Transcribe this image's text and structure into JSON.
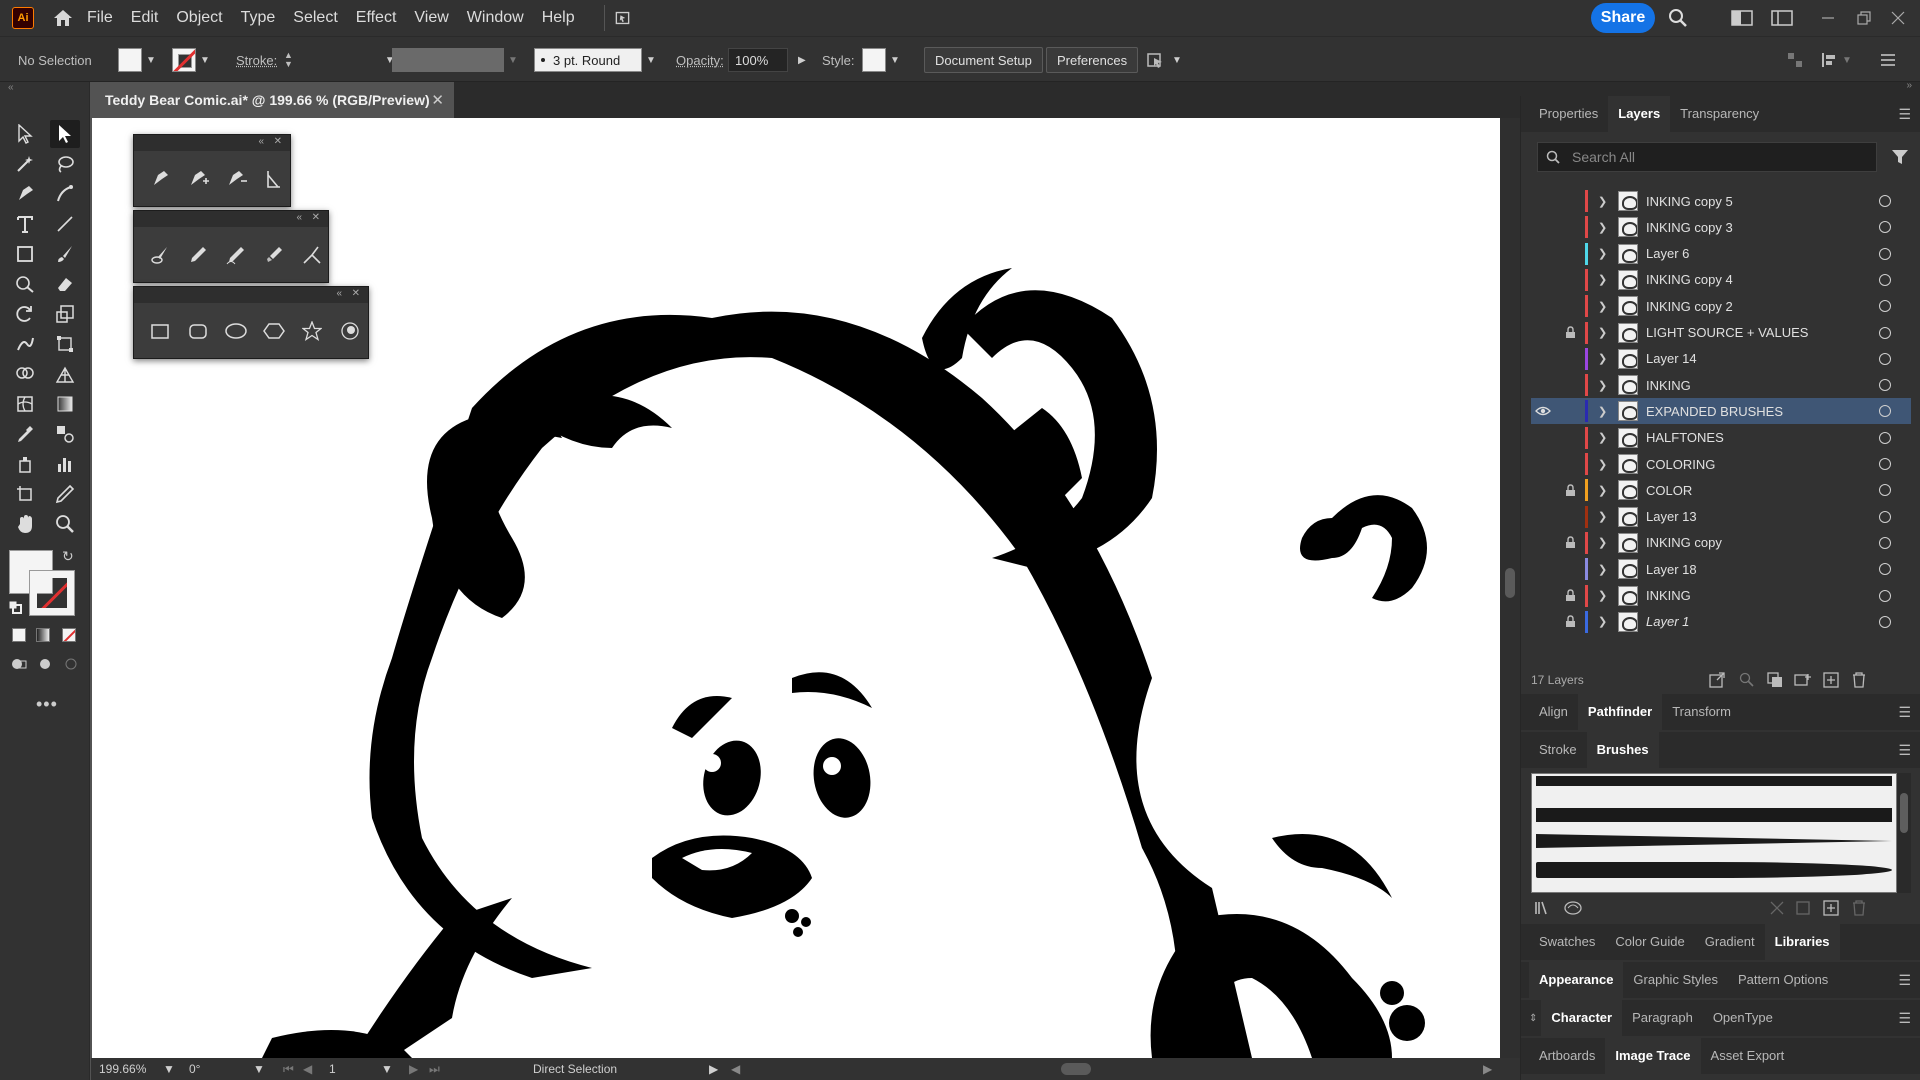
{
  "app": {
    "logo": "Ai",
    "doc_tab": "Teddy Bear Comic.ai* @ 199.66 % (RGB/Preview)"
  },
  "menu": [
    "File",
    "Edit",
    "Object",
    "Type",
    "Select",
    "Effect",
    "View",
    "Window",
    "Help"
  ],
  "share_label": "Share",
  "control": {
    "selection": "No Selection",
    "stroke_label": "Stroke:",
    "brush": "3 pt. Round",
    "opacity_label": "Opacity:",
    "opacity_value": "100%",
    "style_label": "Style:",
    "doc_setup": "Document Setup",
    "preferences": "Preferences"
  },
  "layers_panel": {
    "tabs": [
      "Properties",
      "Layers",
      "Transparency"
    ],
    "active_tab": "Layers",
    "search_placeholder": "Search All",
    "layers": [
      {
        "name": "INKING copy 5",
        "color": "#e04848",
        "locked": false,
        "visible": false
      },
      {
        "name": "INKING copy 3",
        "color": "#e04848",
        "locked": false,
        "visible": false
      },
      {
        "name": "Layer 6",
        "color": "#4fd7e8",
        "locked": false,
        "visible": false
      },
      {
        "name": "INKING copy 4",
        "color": "#e04848",
        "locked": false,
        "visible": false
      },
      {
        "name": "INKING copy 2",
        "color": "#e04848",
        "locked": false,
        "visible": false
      },
      {
        "name": "LIGHT SOURCE + VALUES",
        "color": "#e04848",
        "locked": true,
        "visible": false
      },
      {
        "name": "Layer 14",
        "color": "#9b46e0",
        "locked": false,
        "visible": false
      },
      {
        "name": "INKING",
        "color": "#e04848",
        "locked": false,
        "visible": false
      },
      {
        "name": "EXPANDED BRUSHES",
        "color": "#2a2ab0",
        "locked": false,
        "visible": true
      },
      {
        "name": "HALFTONES",
        "color": "#e04848",
        "locked": false,
        "visible": false
      },
      {
        "name": "COLORING",
        "color": "#e04848",
        "locked": false,
        "visible": false
      },
      {
        "name": "COLOR",
        "color": "#f0a020",
        "locked": true,
        "visible": false
      },
      {
        "name": "Layer 13",
        "color": "#a03010",
        "locked": false,
        "visible": false
      },
      {
        "name": "INKING copy",
        "color": "#e04848",
        "locked": true,
        "visible": false
      },
      {
        "name": "Layer 18",
        "color": "#8a8ae0",
        "locked": false,
        "visible": false
      },
      {
        "name": "INKING",
        "color": "#e04848",
        "locked": true,
        "visible": false
      },
      {
        "name": "Layer 1",
        "color": "#3a6ae0",
        "locked": true,
        "visible": false
      }
    ],
    "count_label": "17 Layers"
  },
  "pathfinder_tabs": [
    "Align",
    "Pathfinder",
    "Transform"
  ],
  "brushes_tabs": [
    "Stroke",
    "Brushes"
  ],
  "swatches_tabs": [
    "Swatches",
    "Color Guide",
    "Gradient",
    "Libraries"
  ],
  "appearance_tabs": [
    "Appearance",
    "Graphic Styles",
    "Pattern Options"
  ],
  "character_tabs": [
    "Character",
    "Paragraph",
    "OpenType"
  ],
  "artboards_tabs": [
    "Artboards",
    "Image Trace",
    "Asset Export"
  ],
  "status": {
    "zoom": "199.66%",
    "rotation": "0°",
    "artboard": "1",
    "tool": "Direct Selection"
  }
}
